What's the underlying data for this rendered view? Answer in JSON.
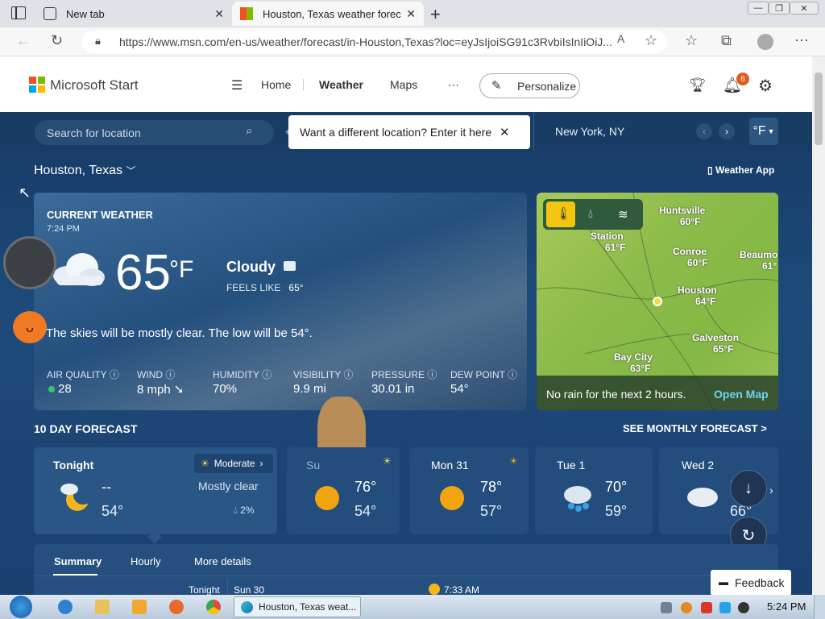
{
  "browser": {
    "tabs": [
      {
        "title": "New tab"
      },
      {
        "title": "Houston, Texas weather forecast"
      }
    ],
    "url": "https://www.msn.com/en-us/weather/forecast/in-Houston,Texas?loc=eyJsIjoiSG91c3RvbiIsInIiOiJ..."
  },
  "header": {
    "brand": "Microsoft Start",
    "nav": [
      "Home",
      "Weather",
      "Maps"
    ],
    "personalize": "Personalize",
    "notifications": "6"
  },
  "search": {
    "placeholder": "Search for location",
    "tooltip": "Want a different location? Enter it here",
    "pinned_city": "New York, NY",
    "unit": "°F"
  },
  "location": "Houston, Texas",
  "weather_app": "Weather App",
  "current": {
    "label": "CURRENT WEATHER",
    "time": "7:24 PM",
    "temp": "65",
    "unit": "°F",
    "condition": "Cloudy",
    "feels_label": "FEELS LIKE",
    "feels_value": "65°",
    "summary": "The skies will be mostly clear. The low will be 54°.",
    "stats": [
      {
        "label": "AIR QUALITY",
        "value": "28"
      },
      {
        "label": "WIND",
        "value": "8 mph"
      },
      {
        "label": "HUMIDITY",
        "value": "70%"
      },
      {
        "label": "VISIBILITY",
        "value": "9.9 mi"
      },
      {
        "label": "PRESSURE",
        "value": "30.01 in"
      },
      {
        "label": "DEW POINT",
        "value": "54°"
      }
    ]
  },
  "map": {
    "cities": [
      {
        "name": "Huntsville",
        "temp": "60°F"
      },
      {
        "name": "Station",
        "temp": "61°F"
      },
      {
        "name": "Conroe",
        "temp": "60°F"
      },
      {
        "name": "Beaumo",
        "temp": "61°"
      },
      {
        "name": "Houston",
        "temp": "64°F"
      },
      {
        "name": "Galveston",
        "temp": "65°F"
      },
      {
        "name": "Bay City",
        "temp": "63°F"
      }
    ],
    "rain_text": "No rain for the next 2 hours.",
    "open_map": "Open Map"
  },
  "forecast": {
    "label": "10 DAY FORECAST",
    "monthly": "SEE MONTHLY FORECAST >",
    "tonight": {
      "name": "Tonight",
      "badge": "Moderate",
      "hi": "--",
      "lo": "54°",
      "desc": "Mostly clear",
      "precip": "2%"
    },
    "days": [
      {
        "name": "Su",
        "hi": "76°",
        "lo": "54°"
      },
      {
        "name": "Mon 31",
        "hi": "78°",
        "lo": "57°"
      },
      {
        "name": "Tue 1",
        "hi": "70°",
        "lo": "59°"
      },
      {
        "name": "Wed 2",
        "hi": "7",
        "lo": "66°"
      }
    ]
  },
  "bottom_tabs": [
    "Summary",
    "Hourly",
    "More details"
  ],
  "bottom_row": {
    "col1": "Tonight",
    "col2": "Sun 30",
    "sunrise": "7:33 AM"
  },
  "feedback": "Feedback",
  "taskbar": {
    "active_item": "Houston, Texas weat...",
    "clock": "5:24 PM"
  }
}
